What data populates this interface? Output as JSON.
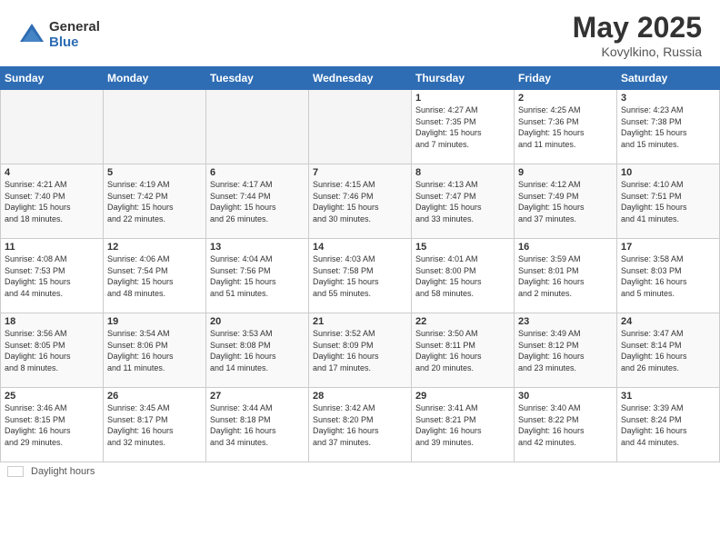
{
  "header": {
    "logo_general": "General",
    "logo_blue": "Blue",
    "title": "May 2025",
    "location": "Kovylkino, Russia"
  },
  "weekdays": [
    "Sunday",
    "Monday",
    "Tuesday",
    "Wednesday",
    "Thursday",
    "Friday",
    "Saturday"
  ],
  "footer": {
    "label": "Daylight hours"
  },
  "weeks": [
    [
      {
        "day": "",
        "info": ""
      },
      {
        "day": "",
        "info": ""
      },
      {
        "day": "",
        "info": ""
      },
      {
        "day": "",
        "info": ""
      },
      {
        "day": "1",
        "info": "Sunrise: 4:27 AM\nSunset: 7:35 PM\nDaylight: 15 hours\nand 7 minutes."
      },
      {
        "day": "2",
        "info": "Sunrise: 4:25 AM\nSunset: 7:36 PM\nDaylight: 15 hours\nand 11 minutes."
      },
      {
        "day": "3",
        "info": "Sunrise: 4:23 AM\nSunset: 7:38 PM\nDaylight: 15 hours\nand 15 minutes."
      }
    ],
    [
      {
        "day": "4",
        "info": "Sunrise: 4:21 AM\nSunset: 7:40 PM\nDaylight: 15 hours\nand 18 minutes."
      },
      {
        "day": "5",
        "info": "Sunrise: 4:19 AM\nSunset: 7:42 PM\nDaylight: 15 hours\nand 22 minutes."
      },
      {
        "day": "6",
        "info": "Sunrise: 4:17 AM\nSunset: 7:44 PM\nDaylight: 15 hours\nand 26 minutes."
      },
      {
        "day": "7",
        "info": "Sunrise: 4:15 AM\nSunset: 7:46 PM\nDaylight: 15 hours\nand 30 minutes."
      },
      {
        "day": "8",
        "info": "Sunrise: 4:13 AM\nSunset: 7:47 PM\nDaylight: 15 hours\nand 33 minutes."
      },
      {
        "day": "9",
        "info": "Sunrise: 4:12 AM\nSunset: 7:49 PM\nDaylight: 15 hours\nand 37 minutes."
      },
      {
        "day": "10",
        "info": "Sunrise: 4:10 AM\nSunset: 7:51 PM\nDaylight: 15 hours\nand 41 minutes."
      }
    ],
    [
      {
        "day": "11",
        "info": "Sunrise: 4:08 AM\nSunset: 7:53 PM\nDaylight: 15 hours\nand 44 minutes."
      },
      {
        "day": "12",
        "info": "Sunrise: 4:06 AM\nSunset: 7:54 PM\nDaylight: 15 hours\nand 48 minutes."
      },
      {
        "day": "13",
        "info": "Sunrise: 4:04 AM\nSunset: 7:56 PM\nDaylight: 15 hours\nand 51 minutes."
      },
      {
        "day": "14",
        "info": "Sunrise: 4:03 AM\nSunset: 7:58 PM\nDaylight: 15 hours\nand 55 minutes."
      },
      {
        "day": "15",
        "info": "Sunrise: 4:01 AM\nSunset: 8:00 PM\nDaylight: 15 hours\nand 58 minutes."
      },
      {
        "day": "16",
        "info": "Sunrise: 3:59 AM\nSunset: 8:01 PM\nDaylight: 16 hours\nand 2 minutes."
      },
      {
        "day": "17",
        "info": "Sunrise: 3:58 AM\nSunset: 8:03 PM\nDaylight: 16 hours\nand 5 minutes."
      }
    ],
    [
      {
        "day": "18",
        "info": "Sunrise: 3:56 AM\nSunset: 8:05 PM\nDaylight: 16 hours\nand 8 minutes."
      },
      {
        "day": "19",
        "info": "Sunrise: 3:54 AM\nSunset: 8:06 PM\nDaylight: 16 hours\nand 11 minutes."
      },
      {
        "day": "20",
        "info": "Sunrise: 3:53 AM\nSunset: 8:08 PM\nDaylight: 16 hours\nand 14 minutes."
      },
      {
        "day": "21",
        "info": "Sunrise: 3:52 AM\nSunset: 8:09 PM\nDaylight: 16 hours\nand 17 minutes."
      },
      {
        "day": "22",
        "info": "Sunrise: 3:50 AM\nSunset: 8:11 PM\nDaylight: 16 hours\nand 20 minutes."
      },
      {
        "day": "23",
        "info": "Sunrise: 3:49 AM\nSunset: 8:12 PM\nDaylight: 16 hours\nand 23 minutes."
      },
      {
        "day": "24",
        "info": "Sunrise: 3:47 AM\nSunset: 8:14 PM\nDaylight: 16 hours\nand 26 minutes."
      }
    ],
    [
      {
        "day": "25",
        "info": "Sunrise: 3:46 AM\nSunset: 8:15 PM\nDaylight: 16 hours\nand 29 minutes."
      },
      {
        "day": "26",
        "info": "Sunrise: 3:45 AM\nSunset: 8:17 PM\nDaylight: 16 hours\nand 32 minutes."
      },
      {
        "day": "27",
        "info": "Sunrise: 3:44 AM\nSunset: 8:18 PM\nDaylight: 16 hours\nand 34 minutes."
      },
      {
        "day": "28",
        "info": "Sunrise: 3:42 AM\nSunset: 8:20 PM\nDaylight: 16 hours\nand 37 minutes."
      },
      {
        "day": "29",
        "info": "Sunrise: 3:41 AM\nSunset: 8:21 PM\nDaylight: 16 hours\nand 39 minutes."
      },
      {
        "day": "30",
        "info": "Sunrise: 3:40 AM\nSunset: 8:22 PM\nDaylight: 16 hours\nand 42 minutes."
      },
      {
        "day": "31",
        "info": "Sunrise: 3:39 AM\nSunset: 8:24 PM\nDaylight: 16 hours\nand 44 minutes."
      }
    ]
  ]
}
